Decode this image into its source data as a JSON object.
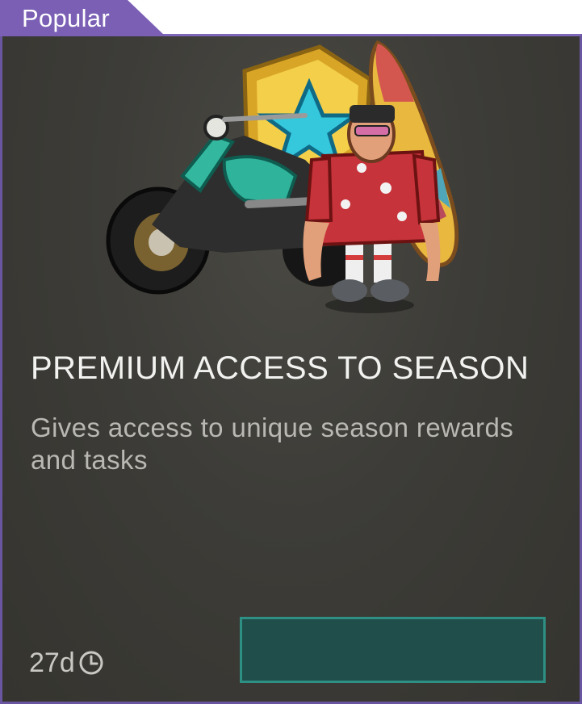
{
  "badge": {
    "label": "Popular"
  },
  "offer": {
    "title": "PREMIUM ACCESS TO SEASON",
    "description": "Gives access to unique season rewards and tasks",
    "image": "season-rewards-artwork: motorcycle, star badge, surfboard, character in hawaiian shirt"
  },
  "timer": {
    "remaining": "27d",
    "icon": "clock-icon"
  },
  "purchase_button": {
    "label": ""
  },
  "colors": {
    "badge": "#7a5fb5",
    "frame_border": "#6a55a0",
    "card_background": "#3d3c38",
    "button_fill": "#204e4a",
    "button_border": "#2e8f85"
  }
}
